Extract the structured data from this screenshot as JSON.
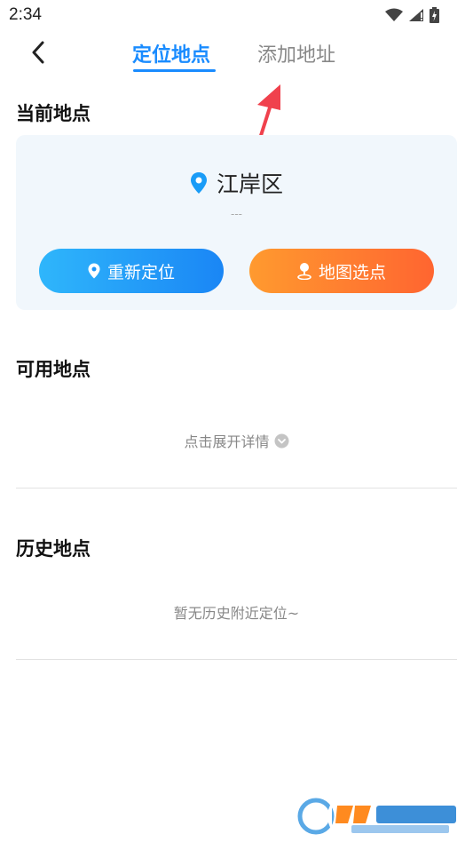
{
  "status_bar": {
    "time": "2:34"
  },
  "nav": {
    "tabs": [
      {
        "label": "定位地点",
        "active": true
      },
      {
        "label": "添加地址",
        "active": false
      }
    ],
    "accent_color": "#1a8cff"
  },
  "current": {
    "title": "当前地点",
    "location_name": "江岸区",
    "location_sub": "---",
    "relocate_label": "重新定位",
    "map_pick_label": "地图选点"
  },
  "available": {
    "title": "可用地点",
    "expand_label": "点击展开详情"
  },
  "history": {
    "title": "历史地点",
    "empty_text": "暂无历史附近定位~"
  },
  "icons": [
    "back-arrow-icon",
    "wifi-icon",
    "signal-icon",
    "battery-icon",
    "location-pin-icon",
    "map-pin-icon",
    "chevron-down-icon"
  ]
}
